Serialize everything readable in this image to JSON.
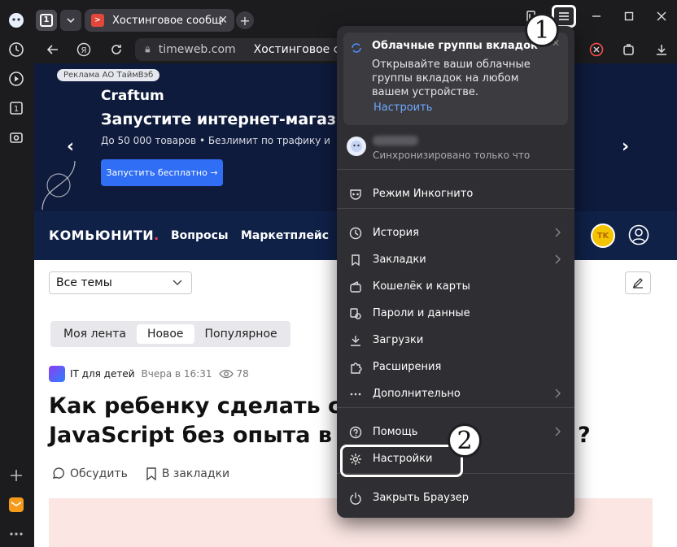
{
  "browser": {
    "tab_count": "1",
    "tab_title": "Хостинговое сообщест",
    "url_domain": "timeweb.com",
    "page_title": "Хостинговое со"
  },
  "ad": {
    "label": "Реклама АО ТаймВэб",
    "brand": "Craftum",
    "headline": "Запустите интернет-магазин",
    "subtitle": "До 50 000 товаров • Безлимит по трафику и",
    "cta": "Запустить бесплатно →"
  },
  "site_nav": {
    "logo": "КОМЬЮНИТИ",
    "logo_dot": ".",
    "links": [
      "Вопросы",
      "Маркетплейс"
    ],
    "user_badge": "TK"
  },
  "page": {
    "filter_value": "Все темы",
    "feed_tabs": [
      "Моя лента",
      "Новое",
      "Популярное"
    ],
    "active_tab": "Новое",
    "author": "IT для детей",
    "time": "Вчера в 16:31",
    "views": "78",
    "title_line1": "Как ребенку сделать св",
    "title_line2": "JavaScript без опыта в п",
    "title_suffix": "?",
    "discuss": "Обсудить",
    "bookmark": "В закладки"
  },
  "menu": {
    "promo_title": "Облачные группы вкладок",
    "promo_text": "Открывайте ваши облачные группы вкладок на любом вашем устройстве.",
    "promo_link": "Настроить",
    "sync_status": "Синхронизировано только что",
    "items": [
      {
        "label": "Режим Инкогнито",
        "icon": "incognito-icon",
        "arrow": false
      },
      {
        "label": "История",
        "icon": "history-icon",
        "arrow": true
      },
      {
        "label": "Закладки",
        "icon": "bookmarks-icon",
        "arrow": true
      },
      {
        "label": "Кошелёк и карты",
        "icon": "wallet-icon",
        "arrow": false
      },
      {
        "label": "Пароли и данные",
        "icon": "passwords-icon",
        "arrow": false
      },
      {
        "label": "Загрузки",
        "icon": "downloads-icon",
        "arrow": false
      },
      {
        "label": "Расширения",
        "icon": "extensions-icon",
        "arrow": false
      },
      {
        "label": "Дополнительно",
        "icon": "more-icon",
        "arrow": true
      },
      {
        "label": "Помощь",
        "icon": "help-icon",
        "arrow": true
      },
      {
        "label": "Настройки",
        "icon": "settings-icon",
        "arrow": false
      },
      {
        "label": "Закрыть Браузер",
        "icon": "power-icon",
        "arrow": false
      }
    ]
  },
  "annotations": {
    "step1": "1",
    "step2": "2"
  },
  "colors": {
    "menu_bg": "#2f2f33",
    "accent": "#2f6ef5",
    "link": "#6ea8ff",
    "nav_bg": "#102148"
  }
}
